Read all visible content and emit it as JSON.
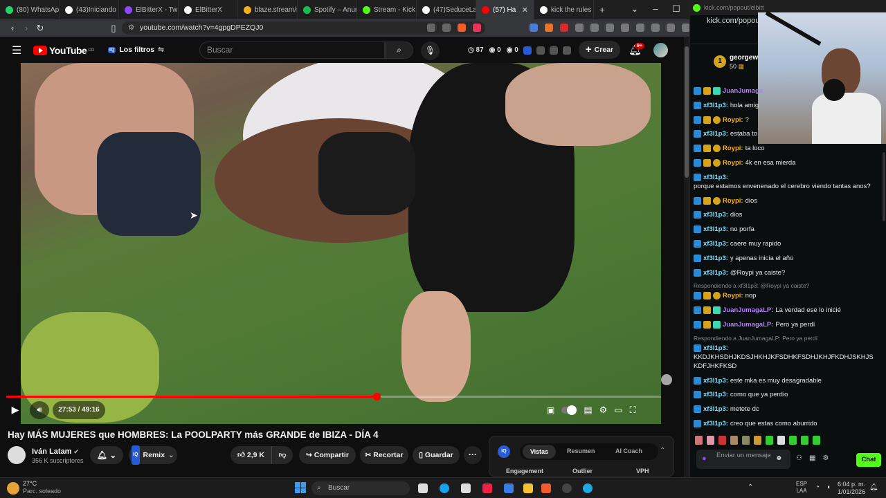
{
  "browser": {
    "tabs": [
      {
        "label": "(80) WhatsApp",
        "color": "#25d366"
      },
      {
        "label": "(43)Iniciando n",
        "color": "#ffffff"
      },
      {
        "label": "ElBitterX - Twi",
        "color": "#9146ff"
      },
      {
        "label": "ElBitterX",
        "color": "#ffffff"
      },
      {
        "label": "blaze.stream/s",
        "color": "#f2b01e"
      },
      {
        "label": "Spotify – Anun",
        "color": "#1db954"
      },
      {
        "label": "Stream - Kick",
        "color": "#53fc18"
      },
      {
        "label": "(47)SeduceLaV",
        "color": "#ffffff"
      },
      {
        "label": "(57) Ha",
        "color": "#ff0000",
        "active": true
      },
      {
        "label": "kick the rules",
        "color": "#ffffff"
      }
    ],
    "new_tab": "+",
    "url": "youtube.com/watch?v=4gpgDPEZQJ0"
  },
  "youtube": {
    "logo_text": "YouTube",
    "logo_region": "CO",
    "filters_label": "Los filtros",
    "search_placeholder": "Buscar",
    "stats": {
      "views_icon": "87",
      "a": "0",
      "b": "0"
    },
    "create_label": "Crear",
    "notif_badge": "9+",
    "player": {
      "time": "27:53 / 49:16",
      "progress": 0.566
    },
    "video_title": "Hay MÁS MUJERES que HOMBRES: La POOLPARTY más GRANDE de IBIZA - DÍA 4",
    "channel": {
      "name": "Iván Latam",
      "subs": "356 K suscriptores"
    },
    "remix_label": "Remix",
    "likes": "2,9 K",
    "share_label": "Compartir",
    "clip_label": "Recortar",
    "save_label": "Guardar",
    "panel": {
      "tabs": [
        "Vistas",
        "Resumen",
        "AI Coach"
      ],
      "cols": [
        "Engagement",
        "Outlier",
        "VPH"
      ]
    }
  },
  "kick": {
    "url": "kick.com/popout/elbitt",
    "title_url": "kick.com/popout/",
    "top_user": "georgew",
    "top_user_count": "50",
    "chat": [
      {
        "user": "JuanJumaga",
        "color": "#b37dff",
        "text": ""
      },
      {
        "user": "xf3l1p3:",
        "color": "#7de0ff",
        "text": "hola amig"
      },
      {
        "user": "Roypi:",
        "color": "#ffb000",
        "text": "?"
      },
      {
        "user": "xf3l1p3:",
        "color": "#7de0ff",
        "text": "estaba to"
      },
      {
        "user": "Roypi:",
        "color": "#ffb000",
        "text": "ta loco"
      },
      {
        "user": "Roypi:",
        "color": "#ffb000",
        "text": "4k en esa mierda"
      },
      {
        "user": "xf3l1p3:",
        "color": "#7de0ff",
        "text": "porque estamos envenenado el cerebro viendo tantas anos?"
      },
      {
        "user": "Roypi:",
        "color": "#ffb000",
        "text": "dios"
      },
      {
        "user": "xf3l1p3:",
        "color": "#7de0ff",
        "text": "dios"
      },
      {
        "user": "xf3l1p3:",
        "color": "#7de0ff",
        "text": "no porfa"
      },
      {
        "user": "xf3l1p3:",
        "color": "#7de0ff",
        "text": "caere muy rapido"
      },
      {
        "user": "xf3l1p3:",
        "color": "#7de0ff",
        "text": "y apenas inicia el año"
      },
      {
        "user": "xf3l1p3:",
        "color": "#7de0ff",
        "text": "@Roypi ya caiste?"
      },
      {
        "reply": "Respondiendo a xf3l1p3: @Roypi ya caiste?",
        "user": "Roypi:",
        "color": "#ffb000",
        "text": "nop"
      },
      {
        "user": "JuanJumagaLP:",
        "color": "#b37dff",
        "text": "La verdad ese lo inicié"
      },
      {
        "user": "JuanJumagaLP:",
        "color": "#b37dff",
        "text": "Pero ya perdí"
      },
      {
        "reply": "Respondiendo a JuanJumagaLP: Pero ya perdí",
        "user": "xf3l1p3:",
        "color": "#7de0ff",
        "text": "KKDJKHSDHJKDSJHKHJKFSDHKFSDHJKHJFKDHJSKHJSKDFJHKFKSD"
      },
      {
        "user": "xf3l1p3:",
        "color": "#7de0ff",
        "text": "este mka es muy desagradable"
      },
      {
        "user": "xf3l1p3:",
        "color": "#7de0ff",
        "text": "como que ya perdio"
      },
      {
        "user": "xf3l1p3:",
        "color": "#7de0ff",
        "text": "metete dc"
      },
      {
        "user": "xf3l1p3:",
        "color": "#7de0ff",
        "text": "creo que estas como aburrido"
      }
    ],
    "send_placeholder": "Enviar un mensaje",
    "chat_button": "Chat"
  },
  "taskbar": {
    "weather_temp": "27°C",
    "weather_desc": "Parc. soleado",
    "search": "Buscar",
    "lang_top": "ESP",
    "lang_bot": "LAA",
    "time": "6:04 p. m.",
    "date": "1/01/2026"
  }
}
